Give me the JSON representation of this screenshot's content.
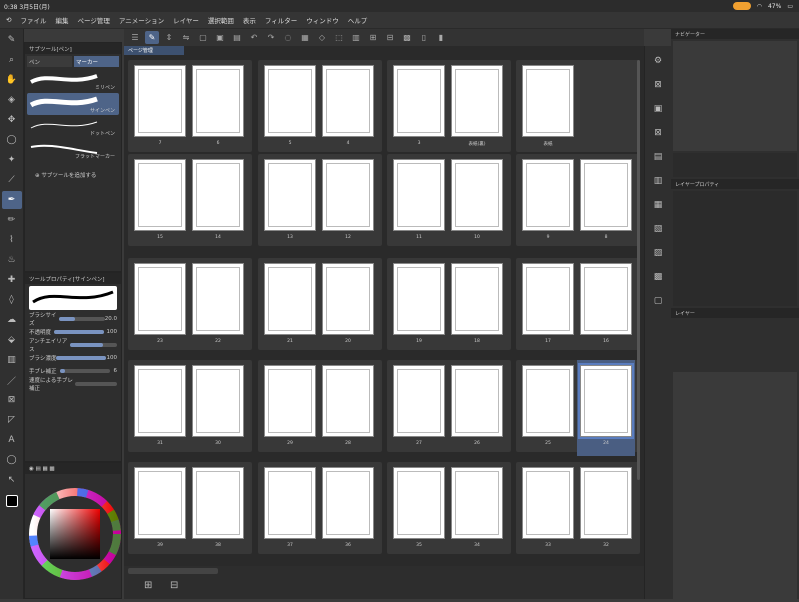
{
  "status_bar": {
    "time": "0:38",
    "date": "3月5日(月)",
    "battery": "47%"
  },
  "menu": [
    "ファイル",
    "編集",
    "ページ管理",
    "アニメーション",
    "レイヤー",
    "選択範囲",
    "表示",
    "フィルター",
    "ウィンドウ",
    "ヘルプ"
  ],
  "subtool_panel": {
    "title": "サブツール[ペン]",
    "tabs": [
      "ペン",
      "マーカー"
    ],
    "brushes": [
      "ミリペン",
      "サインペン",
      "ドットペン",
      "フラットマーカー"
    ],
    "add_label": "サブツールを追加する"
  },
  "tool_property": {
    "title": "ツールプロパティ[サインペン]",
    "rows": [
      {
        "label": "ブラシサイズ",
        "value": "20.0",
        "level": 0.35
      },
      {
        "label": "不透明度",
        "value": "100",
        "level": 1.0
      },
      {
        "label": "アンチエイリアス",
        "value": "",
        "level": 0.7
      },
      {
        "label": "ブラシ濃度",
        "value": "100",
        "level": 1.0
      },
      {
        "label": "手ブレ補正",
        "value": "6",
        "level": 0.1
      },
      {
        "label": "速度による手ブレ補正",
        "value": "",
        "level": 0
      }
    ]
  },
  "pages_panel": {
    "title": "ページ管理"
  },
  "right_panels": {
    "navigator": "ナビゲーター",
    "layer_property": "レイヤープロパティ",
    "layer": "レイヤー"
  },
  "spreads": [
    [
      "7",
      "6"
    ],
    [
      "5",
      "4"
    ],
    [
      "3",
      "表紙(裏)"
    ],
    [
      "表紙"
    ],
    [
      "15",
      "14"
    ],
    [
      "13",
      "12"
    ],
    [
      "11",
      "10"
    ],
    [
      "9",
      "8"
    ],
    [
      "23",
      "22"
    ],
    [
      "21",
      "20"
    ],
    [
      "19",
      "18"
    ],
    [
      "17",
      "16"
    ],
    [
      "31",
      "30"
    ],
    [
      "29",
      "28"
    ],
    [
      "27",
      "26"
    ],
    [
      "25",
      "24"
    ],
    [
      "39",
      "38"
    ],
    [
      "37",
      "36"
    ],
    [
      "35",
      "34"
    ],
    [
      "33",
      "32"
    ]
  ],
  "selected_page": "24",
  "colors": {
    "accent": "#4e6488",
    "selection": "#5a7dbf",
    "status_pill": "#f0a030"
  }
}
